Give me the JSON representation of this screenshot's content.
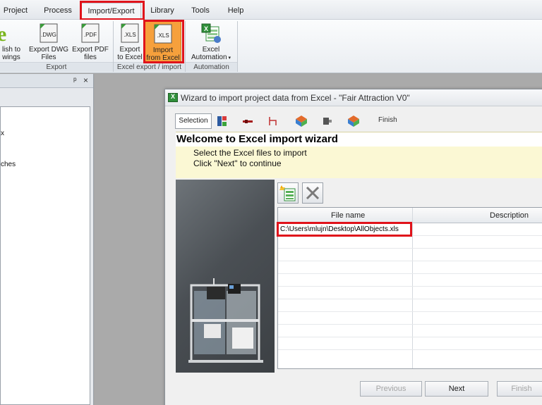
{
  "menu": {
    "tabs": [
      "Project",
      "Process",
      "Import/Export",
      "Library",
      "Tools",
      "Help"
    ],
    "active_tab": "Import/Export"
  },
  "ribbon": {
    "buttons": {
      "publish": [
        "lish to",
        "wings"
      ],
      "export_dwg": [
        "Export DWG",
        "Files"
      ],
      "export_pdf": [
        "Export PDF",
        "files"
      ],
      "export_excel": [
        "Export",
        "to Excel"
      ],
      "import_excel": [
        "Import",
        "from Excel"
      ],
      "excel_automation": [
        "Excel",
        "Automation"
      ]
    },
    "icons": {
      "dwg": ".DWG",
      "pdf": ".PDF",
      "xls": ".XLS"
    },
    "groups": {
      "export": "Export",
      "excel_export_import": "Excel export / import",
      "automation": "Automation"
    }
  },
  "left_panel": {
    "pin_icon": "ᵖ",
    "close_icon": "×",
    "items": [
      "x",
      "ches"
    ]
  },
  "dialog": {
    "title": "Wizard to import project data from Excel - \"Fair Attraction V0\"",
    "steps": {
      "selection": "Selection",
      "finish": "Finish"
    },
    "welcome": {
      "heading": "Welcome to Excel import wizard",
      "line1": "Select the Excel files to import",
      "line2": "Click \"Next\" to continue"
    },
    "grid": {
      "columns": [
        "File name",
        "Description"
      ],
      "rows": [
        {
          "file": "C:\\Users\\mlujn\\Desktop\\AllObjects.xls",
          "description": ""
        }
      ]
    },
    "buttons": {
      "previous": "Previous",
      "next": "Next",
      "finish": "Finish"
    }
  },
  "colors": {
    "highlight": "#e0131b",
    "accent_orange": "#f28c1e",
    "excel_green": "#2f8f3a",
    "welcome_bg": "#fbf8d4"
  }
}
